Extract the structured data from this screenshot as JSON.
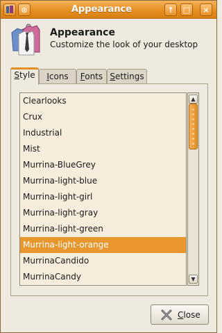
{
  "window": {
    "title": "Appearance",
    "titlebar_buttons": {
      "menu": "⊙",
      "up": "↑",
      "maximize": "□",
      "close": "×"
    }
  },
  "header": {
    "title": "Appearance",
    "subtitle": "Customize the look of your desktop",
    "icon": "shirt-tie-icon"
  },
  "tabs": [
    {
      "first": "S",
      "rest": "tyle",
      "active": true
    },
    {
      "first": "I",
      "rest": "cons",
      "active": false
    },
    {
      "first": "F",
      "rest": "onts",
      "active": false
    },
    {
      "first": "S",
      "rest": "ettings",
      "active": false
    }
  ],
  "themes": {
    "items": [
      "Clearlooks",
      "Crux",
      "Industrial",
      "Mist",
      "Murrina-BlueGrey",
      "Murrina-light-blue",
      "Murrina-light-girl",
      "Murrina-light-gray",
      "Murrina-light-green",
      "Murrina-light-orange",
      "MurrinaCandido",
      "MurrinaCandy"
    ],
    "selected": "Murrina-light-orange"
  },
  "buttons": {
    "close_first": "C",
    "close_rest": "lose"
  },
  "colors": {
    "accent": "#e48f22",
    "selection": "#e8962e",
    "list_bg": "#f6eddd"
  }
}
